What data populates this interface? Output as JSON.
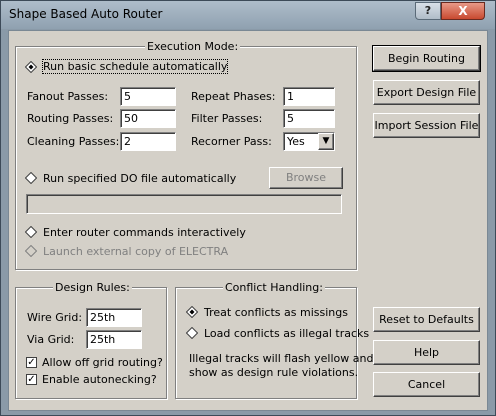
{
  "window": {
    "title": "Shape Based Auto Router",
    "help_glyph": "?",
    "close_glyph": "X"
  },
  "execution": {
    "legend": "Execution Mode:",
    "run_basic": "Run basic schedule automatically",
    "fanout_label": "Fanout Passes:",
    "fanout_value": "5",
    "routing_label": "Routing Passes:",
    "routing_value": "50",
    "cleaning_label": "Cleaning Passes:",
    "cleaning_value": "2",
    "repeat_label": "Repeat Phases:",
    "repeat_value": "1",
    "filter_label": "Filter Passes:",
    "filter_value": "5",
    "recorner_label": "Recorner Pass:",
    "recorner_value": "Yes",
    "run_do": "Run specified DO file automatically",
    "browse": "Browse",
    "do_file_value": "",
    "interactive": "Enter router commands interactively",
    "launch": "Launch external copy of ELECTRA"
  },
  "design_rules": {
    "legend": "Design Rules:",
    "wire_label": "Wire Grid:",
    "wire_value": "25th",
    "via_label": "Via Grid:",
    "via_value": "25th",
    "allow_off": "Allow off grid routing?",
    "autonecking": "Enable autonecking?"
  },
  "conflict": {
    "legend": "Conflict Handling:",
    "treat": "Treat conflicts as missings",
    "load": "Load conflicts as illegal tracks",
    "note1": "Illegal tracks will flash yellow and",
    "note2": "show as design rule violations."
  },
  "buttons": {
    "begin": "Begin Routing",
    "export": "Export Design File",
    "import": "Import Session File",
    "reset": "Reset to Defaults",
    "help": "Help",
    "cancel": "Cancel"
  }
}
